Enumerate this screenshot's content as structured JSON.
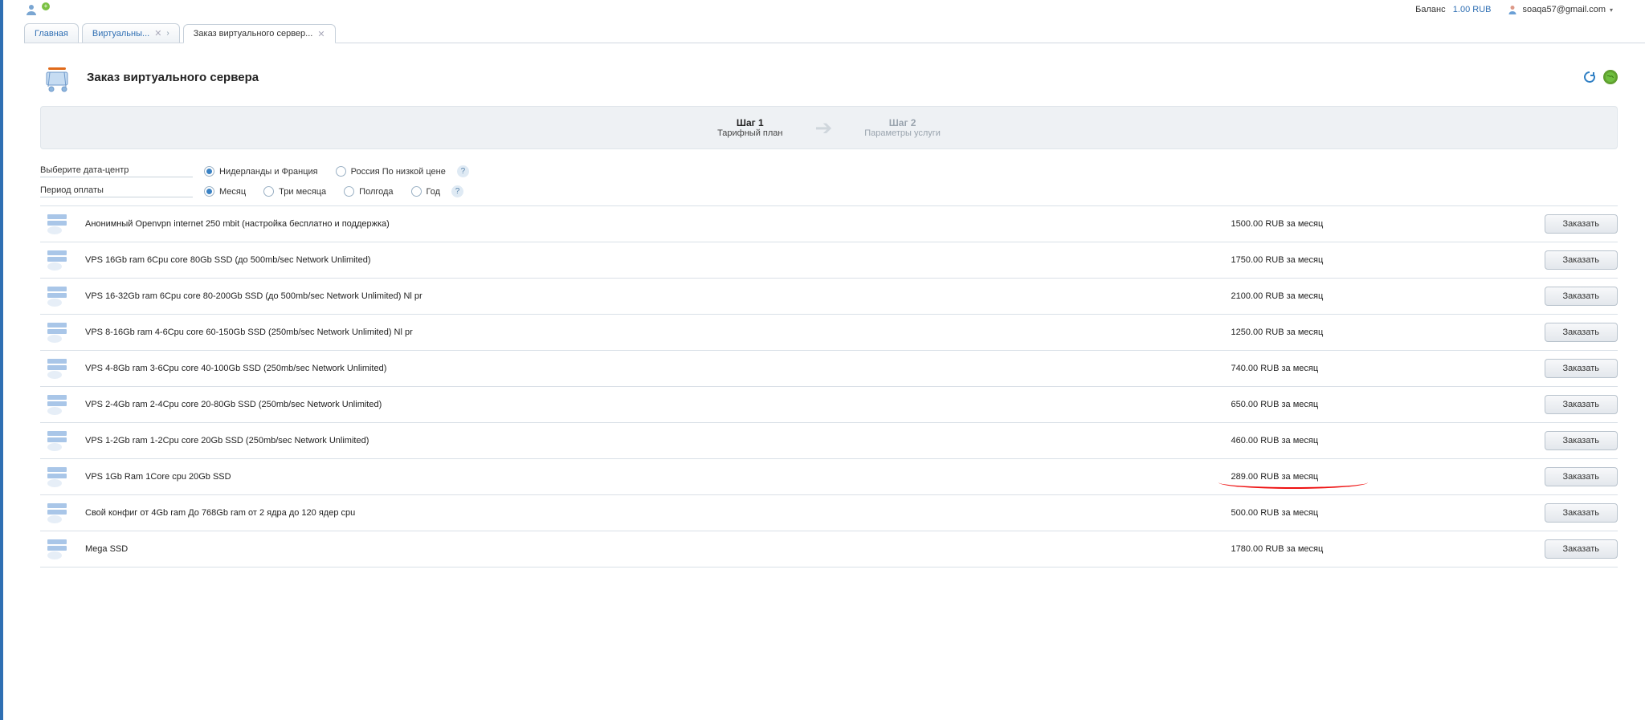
{
  "topbar": {
    "balance_label": "Баланс",
    "balance_value": "1.00 RUB",
    "user_email": "soaqa57@gmail.com"
  },
  "tabs": [
    {
      "label": "Главная",
      "closable": false,
      "active": false
    },
    {
      "label": "Виртуальны...",
      "closable": true,
      "active": false,
      "has_chevron": true
    },
    {
      "label": "Заказ виртуального сервер...",
      "closable": true,
      "active": true
    }
  ],
  "page": {
    "title": "Заказ виртуального сервера"
  },
  "steps": {
    "step1": {
      "title": "Шаг 1",
      "sub": "Тарифный план"
    },
    "step2": {
      "title": "Шаг 2",
      "sub": "Параметры услуги"
    }
  },
  "filters": {
    "datacenter_label": "Выберите дата-центр",
    "datacenter_options": [
      {
        "label": "Нидерланды и Франция",
        "selected": true
      },
      {
        "label": "Россия По низкой цене",
        "selected": false
      }
    ],
    "period_label": "Период оплаты",
    "period_options": [
      {
        "label": "Месяц",
        "selected": true
      },
      {
        "label": "Три месяца",
        "selected": false
      },
      {
        "label": "Полгода",
        "selected": false
      },
      {
        "label": "Год",
        "selected": false
      }
    ]
  },
  "order_button_label": "Заказать",
  "plans": [
    {
      "name": "Анонимный Openvpn internet 250 mbit (настройка бесплатно и поддержка)",
      "price": "1500.00 RUB за месяц",
      "highlight": false
    },
    {
      "name": "VPS 16Gb ram 6Cpu core 80Gb SSD (до 500mb/sec Network Unlimited)",
      "price": "1750.00 RUB за месяц",
      "highlight": false
    },
    {
      "name": "VPS 16-32Gb ram 6Cpu core 80-200Gb SSD (до 500mb/sec Network Unlimited) Nl pr",
      "price": "2100.00 RUB за месяц",
      "highlight": false
    },
    {
      "name": "VPS 8-16Gb ram 4-6Cpu core 60-150Gb SSD (250mb/sec Network Unlimited) Nl pr",
      "price": "1250.00 RUB за месяц",
      "highlight": false
    },
    {
      "name": "VPS 4-8Gb ram 3-6Cpu core 40-100Gb SSD (250mb/sec Network Unlimited)",
      "price": "740.00 RUB за месяц",
      "highlight": false
    },
    {
      "name": "VPS 2-4Gb ram 2-4Cpu core 20-80Gb SSD (250mb/sec Network Unlimited)",
      "price": "650.00 RUB за месяц",
      "highlight": false
    },
    {
      "name": "VPS 1-2Gb ram 1-2Cpu core 20Gb SSD (250mb/sec Network Unlimited)",
      "price": "460.00 RUB за месяц",
      "highlight": false
    },
    {
      "name": "VPS 1Gb Ram 1Core cpu 20Gb SSD",
      "price": "289.00 RUB за месяц",
      "highlight": true
    },
    {
      "name": "Свой конфиг от 4Gb ram До 768Gb ram от 2 ядра до 120 ядер cpu",
      "price": "500.00 RUB за месяц",
      "highlight": false
    },
    {
      "name": "Mega SSD",
      "price": "1780.00 RUB за месяц",
      "highlight": false
    }
  ]
}
